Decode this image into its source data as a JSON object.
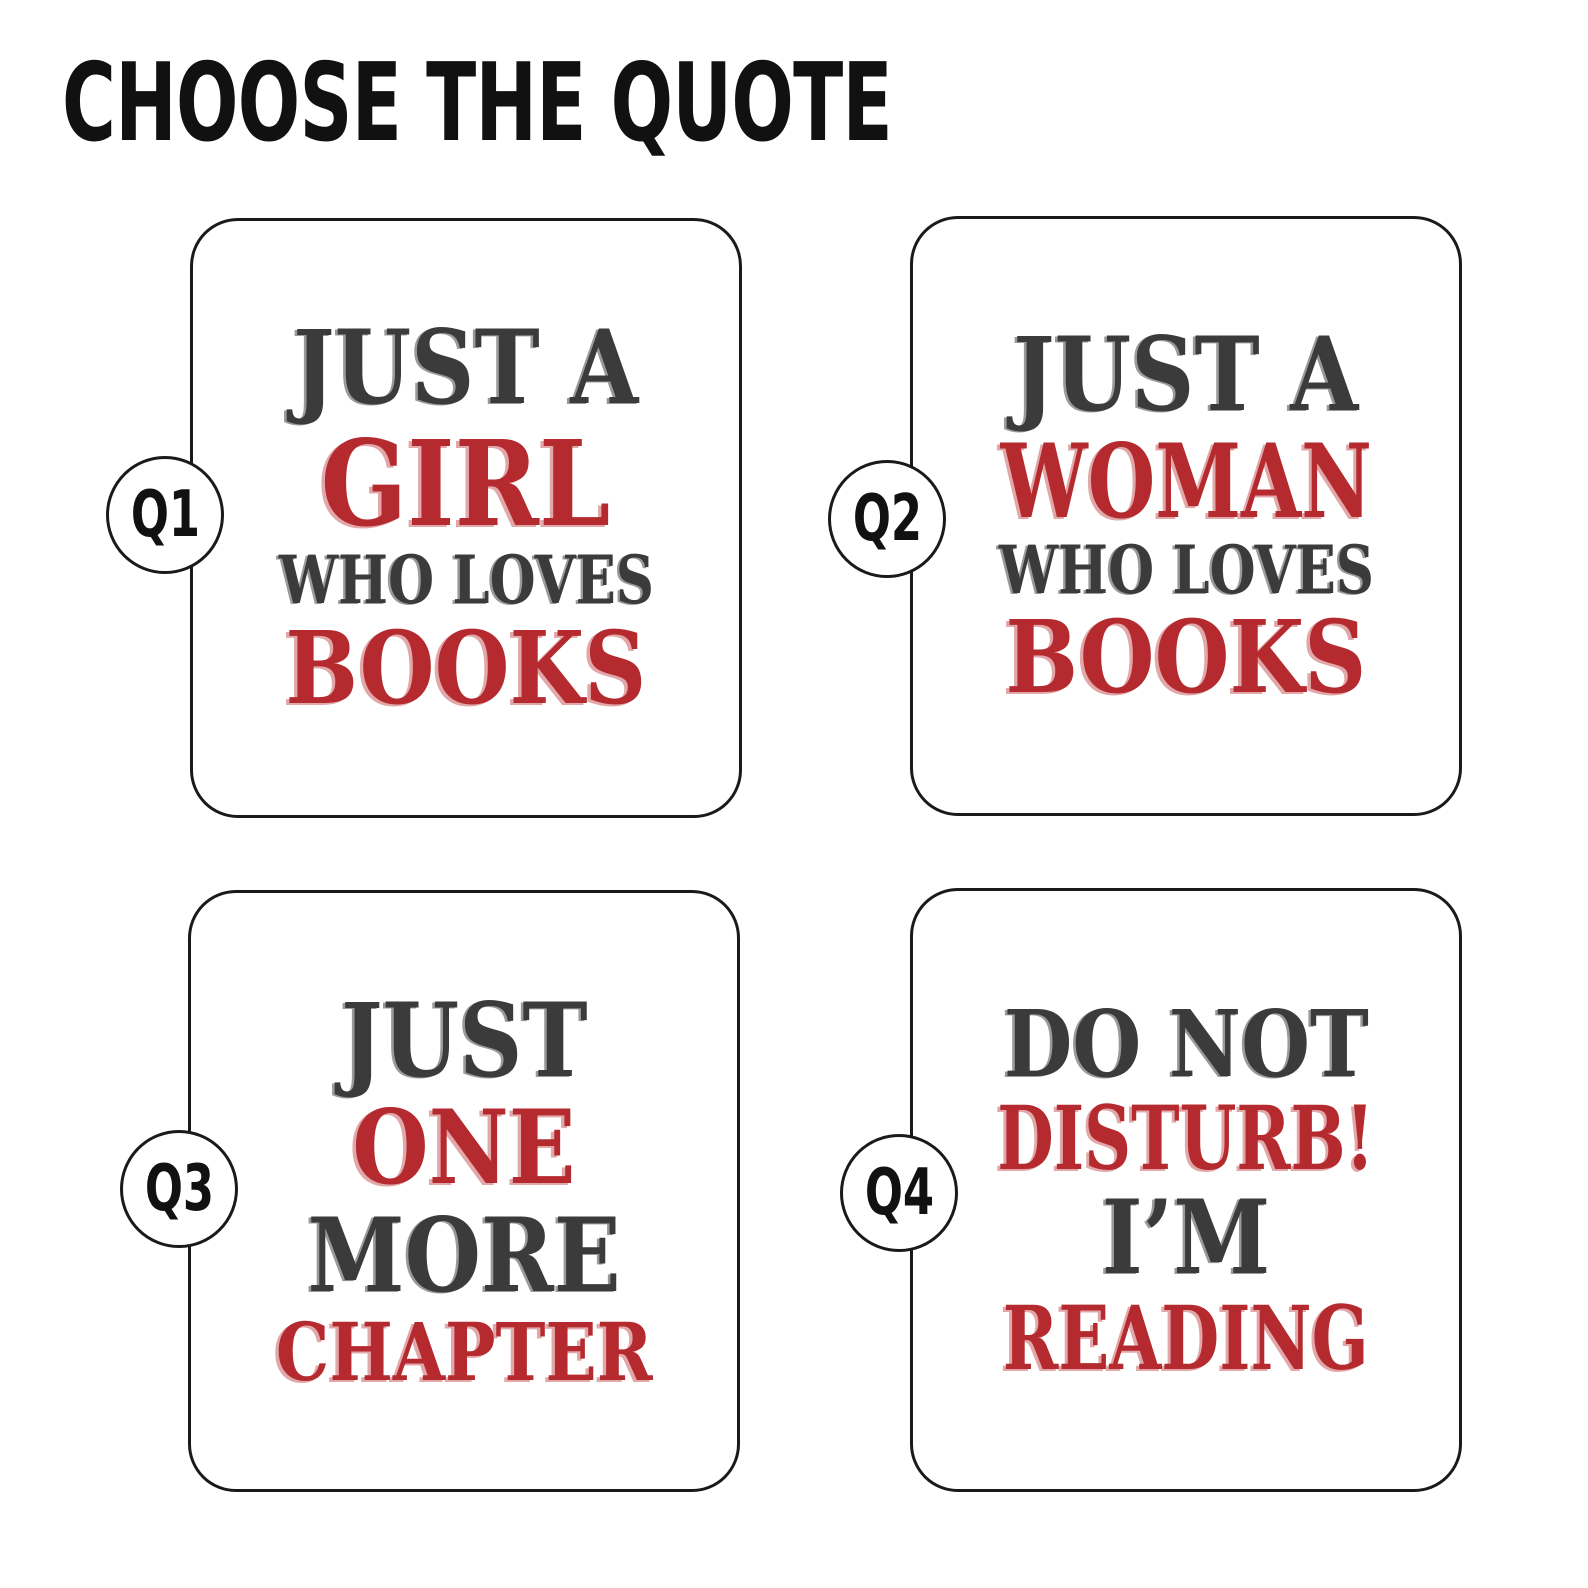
{
  "title": "CHOOSE THE QUOTE",
  "colors": {
    "accent_red": "#b52a2e",
    "text_dark": "#3b3b3b",
    "border": "#1a1a1a"
  },
  "quotes": [
    {
      "badge": "Q1",
      "lines": [
        {
          "text": "JUST A",
          "color": "dark"
        },
        {
          "text": "GIRL",
          "color": "red"
        },
        {
          "text": "WHO LOVES",
          "color": "dark"
        },
        {
          "text": "BOOKS",
          "color": "red"
        }
      ]
    },
    {
      "badge": "Q2",
      "lines": [
        {
          "text": "JUST A",
          "color": "dark"
        },
        {
          "text": "WOMAN",
          "color": "red"
        },
        {
          "text": "WHO LOVES",
          "color": "dark"
        },
        {
          "text": "BOOKS",
          "color": "red"
        }
      ]
    },
    {
      "badge": "Q3",
      "lines": [
        {
          "text": "JUST",
          "color": "dark"
        },
        {
          "text": "ONE",
          "color": "red"
        },
        {
          "text": "MORE",
          "color": "dark"
        },
        {
          "text": "CHAPTER",
          "color": "red"
        }
      ]
    },
    {
      "badge": "Q4",
      "lines": [
        {
          "text": "DO NOT",
          "color": "dark"
        },
        {
          "text": "DISTURB!",
          "color": "red"
        },
        {
          "text": "I’M",
          "color": "dark"
        },
        {
          "text": "READING",
          "color": "red"
        }
      ]
    }
  ]
}
